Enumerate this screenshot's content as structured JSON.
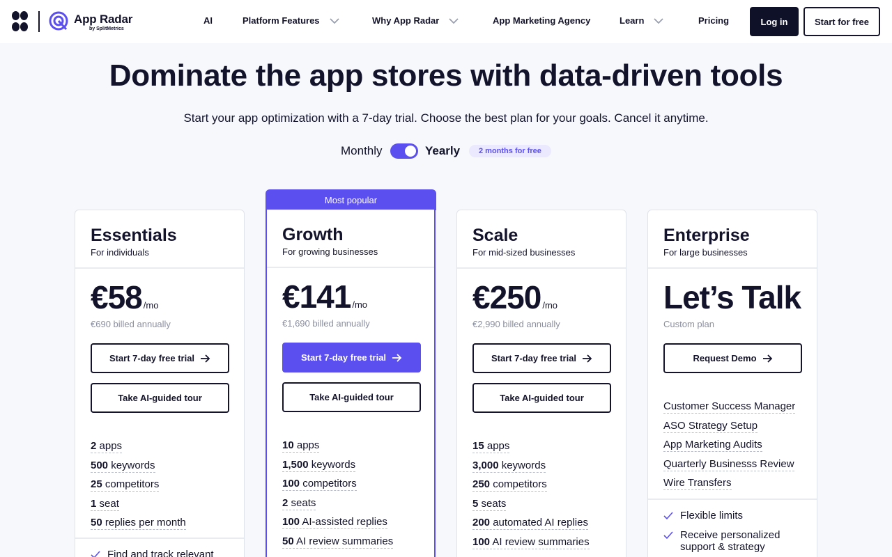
{
  "header": {
    "brand_name": "App Radar",
    "brand_sub": "by SplitMetrics",
    "nav": [
      {
        "label": "AI",
        "has_dropdown": false
      },
      {
        "label": "Platform Features",
        "has_dropdown": true
      },
      {
        "label": "Why App Radar",
        "has_dropdown": true
      },
      {
        "label": "App Marketing Agency",
        "has_dropdown": false
      },
      {
        "label": "Learn",
        "has_dropdown": true
      },
      {
        "label": "Pricing",
        "has_dropdown": false
      }
    ],
    "login_label": "Log in",
    "start_label": "Start for free"
  },
  "hero": {
    "title": "Dominate the app stores with data-driven tools",
    "subtitle": "Start your app optimization with a 7-day trial. Choose the best plan for your goals. Cancel it anytime."
  },
  "billing": {
    "monthly_label": "Monthly",
    "yearly_label": "Yearly",
    "selected": "Yearly",
    "promo_badge": "2 months for free"
  },
  "colors": {
    "accent": "#5b4ff0",
    "dark": "#13132b",
    "muted": "#8b8fa0"
  },
  "plans": [
    {
      "name": "Essentials",
      "for": "For individuals",
      "price": "€58",
      "unit": "/mo",
      "billed": "€690 billed annually",
      "trial_label": "Start 7-day free trial",
      "tour_label": "Take AI-guided tour",
      "features": [
        {
          "value": "2",
          "label": "apps"
        },
        {
          "value": "500",
          "label": "keywords"
        },
        {
          "value": "25",
          "label": "competitors"
        },
        {
          "value": "1",
          "label": "seat"
        },
        {
          "value": "50",
          "label": "replies per month"
        }
      ],
      "check_first": "Find and track relevant"
    },
    {
      "name": "Growth",
      "for": "For growing businesses",
      "badge": "Most popular",
      "price": "€141",
      "unit": "/mo",
      "billed": "€1,690 billed annually",
      "trial_label": "Start 7-day free trial",
      "tour_label": "Take AI-guided tour",
      "features": [
        {
          "value": "10",
          "label": "apps"
        },
        {
          "value": "1,500",
          "label": "keywords"
        },
        {
          "value": "100",
          "label": "competitors"
        },
        {
          "value": "2",
          "label": "seats"
        },
        {
          "value": "100",
          "label": "AI-assisted replies"
        },
        {
          "value": "50",
          "label": "AI review summaries"
        }
      ]
    },
    {
      "name": "Scale",
      "for": "For mid-sized businesses",
      "price": "€250",
      "unit": "/mo",
      "billed": "€2,990 billed annually",
      "trial_label": "Start 7-day free trial",
      "tour_label": "Take AI-guided tour",
      "features": [
        {
          "value": "15",
          "label": "apps"
        },
        {
          "value": "3,000",
          "label": "keywords"
        },
        {
          "value": "250",
          "label": "competitors"
        },
        {
          "value": "5",
          "label": "seats"
        },
        {
          "value": "200",
          "label": "automated AI replies"
        },
        {
          "value": "100",
          "label": "AI review summaries"
        }
      ]
    },
    {
      "name": "Enterprise",
      "for": "For large businesses",
      "price": "Let’s Talk",
      "billed": "Custom plan",
      "demo_label": "Request Demo",
      "features": [
        "Customer Success Manager",
        "ASO Strategy Setup",
        "App Marketing Audits",
        "Quarterly Businesss Review",
        "Wire Transfers"
      ],
      "checks": [
        "Flexible limits",
        "Receive personalized support & strategy"
      ]
    }
  ]
}
